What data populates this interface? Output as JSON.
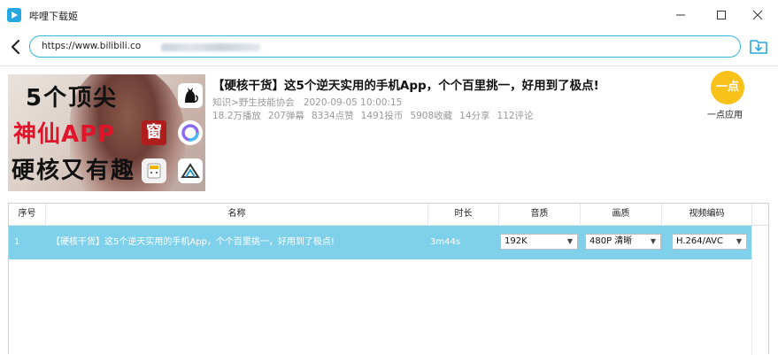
{
  "window": {
    "title": "哔哩下载姬"
  },
  "urlbar": {
    "url_visible": "https://www.bilibili.co"
  },
  "video": {
    "title": "【硬核干货】这5个逆天实用的手机App，个个百里挑一，好用到了极点!",
    "category": "知识>野生技能协会",
    "date": "2020-09-05 10:00:15",
    "stats": [
      "18.2万播放",
      "207弹幕",
      "8334点赞",
      "1491投币",
      "5908收藏",
      "14分享",
      "112评论"
    ],
    "thumbnail": {
      "line1": "5个顶尖",
      "line2": "神仙APP",
      "line3": "硬核又有趣",
      "badge_window": "窗"
    }
  },
  "quick_app": {
    "icon_text": "一点",
    "label": "一点应用"
  },
  "table": {
    "headers": [
      "序号",
      "名称",
      "时长",
      "音质",
      "画质",
      "视频编码"
    ],
    "rows": [
      {
        "index": "1",
        "name": "【硬核干货】这5个逆天实用的手机App，个个百里挑一，好用到了极点!",
        "duration": "3m44s",
        "audio": "192K",
        "video": "480P 清晰",
        "codec": "H.264/AVC"
      }
    ]
  },
  "colors": {
    "accent": "#35b3e0",
    "selected_row": "#7fd0ea",
    "quick_app": "#f9c21a"
  }
}
